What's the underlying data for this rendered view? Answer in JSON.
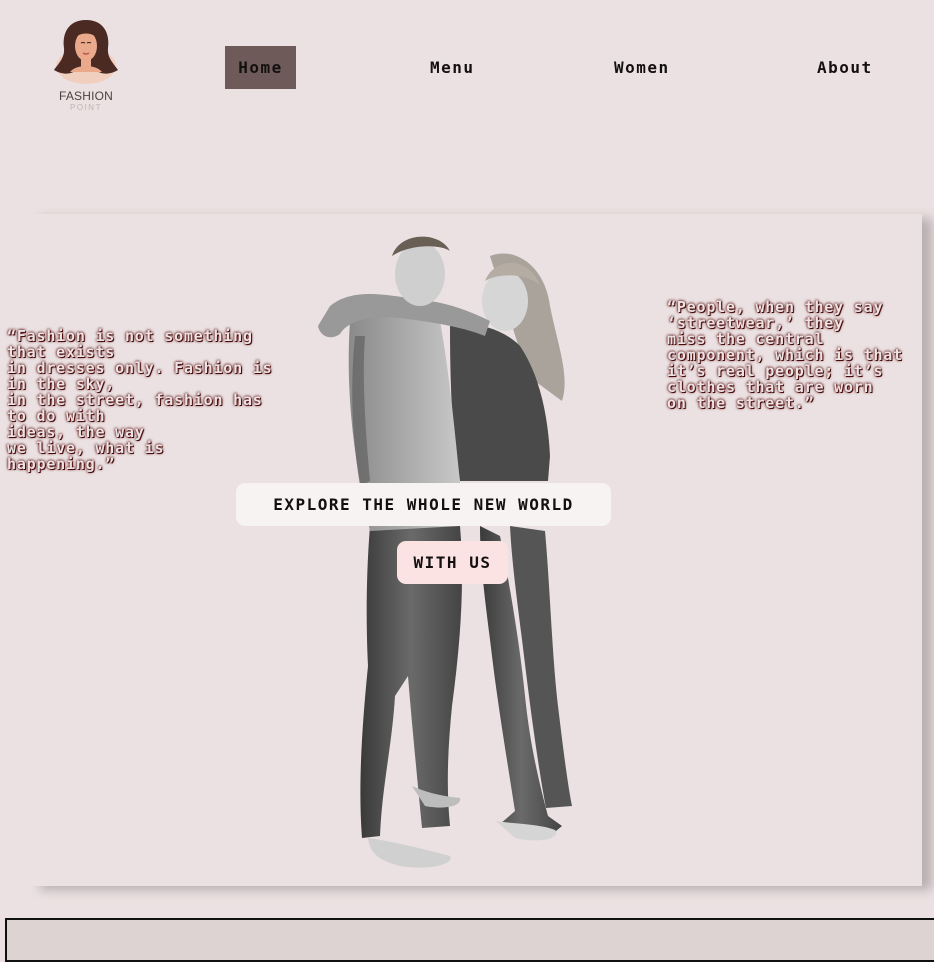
{
  "logo": {
    "name": "FASHION",
    "subtitle": "POINT"
  },
  "nav": {
    "items": [
      {
        "label": "Home",
        "active": true
      },
      {
        "label": "Menu"
      },
      {
        "label": "Women"
      },
      {
        "label": "About"
      }
    ]
  },
  "hero": {
    "quote_left": "“Fashion is not something\nthat exists\nin dresses only. Fashion is\nin the sky,\nin the street, fashion has\nto do with\nideas, the way\nwe live, what is\nhappening.”",
    "quote_right": "“People, when they say\n‘streetwear,’ they\nmiss the central\ncomponent, which is that\nit’s real people; it’s\nclothes that are worn\non the street.”",
    "cta_primary": "EXPLORE THE WHOLE NEW WORLD",
    "cta_secondary": "WITH US"
  },
  "colors": {
    "background": "#ebe1e2",
    "nav_active": "#6d5a59",
    "quote_glow": "#5a1010"
  }
}
